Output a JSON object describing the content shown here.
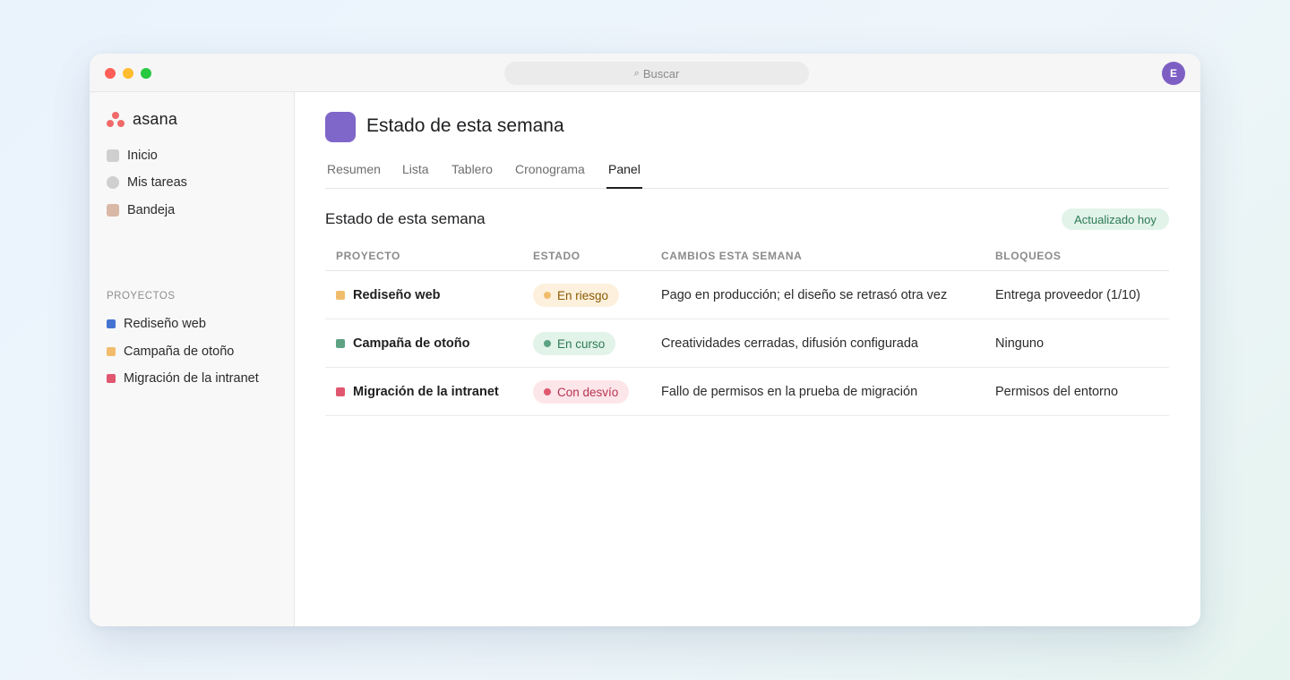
{
  "search": {
    "label": "Buscar"
  },
  "user": {
    "initial": "E"
  },
  "brand": {
    "name": "asana"
  },
  "nav": [
    {
      "label": "Inicio"
    },
    {
      "label": "Mis tareas"
    },
    {
      "label": "Bandeja"
    }
  ],
  "projects_section": {
    "label": "PROYECTOS"
  },
  "projects": [
    {
      "label": "Rediseño web",
      "color": "#4573d2"
    },
    {
      "label": "Campaña de otoño",
      "color": "#f1bd6c"
    },
    {
      "label": "Migración de la intranet",
      "color": "#e0576f"
    }
  ],
  "page": {
    "title": "Estado de esta semana"
  },
  "tabs": [
    {
      "label": "Resumen"
    },
    {
      "label": "Lista"
    },
    {
      "label": "Tablero"
    },
    {
      "label": "Cronograma"
    },
    {
      "label": "Panel",
      "active": true
    }
  ],
  "section": {
    "title": "Estado de esta semana",
    "badge": "Actualizado hoy"
  },
  "table": {
    "headers": [
      "PROYECTO",
      "ESTADO",
      "CAMBIOS ESTA SEMANA",
      "BLOQUEOS"
    ],
    "rows": [
      {
        "project": "Rediseño web",
        "dot_color": "#f1bd6c",
        "status": "En riesgo",
        "status_bg": "#fdf1de",
        "status_fg": "#8a5a00",
        "status_dot": "#f1bd6c",
        "changes": "Pago en producción; el diseño se retrasó otra vez",
        "blockers": "Entrega proveedor (1/10)"
      },
      {
        "project": "Campaña de otoño",
        "dot_color": "#5da283",
        "status": "En curso",
        "status_bg": "#e2f3ea",
        "status_fg": "#2d7a53",
        "status_dot": "#5da283",
        "changes": "Creatividades cerradas, difusión configurada",
        "blockers": "Ninguno"
      },
      {
        "project": "Migración de la intranet",
        "dot_color": "#e0576f",
        "status": "Con desvío",
        "status_bg": "#fde6ea",
        "status_fg": "#b83350",
        "status_dot": "#e0576f",
        "changes": "Fallo de permisos en la prueba de migración",
        "blockers": "Permisos del entorno"
      }
    ]
  }
}
